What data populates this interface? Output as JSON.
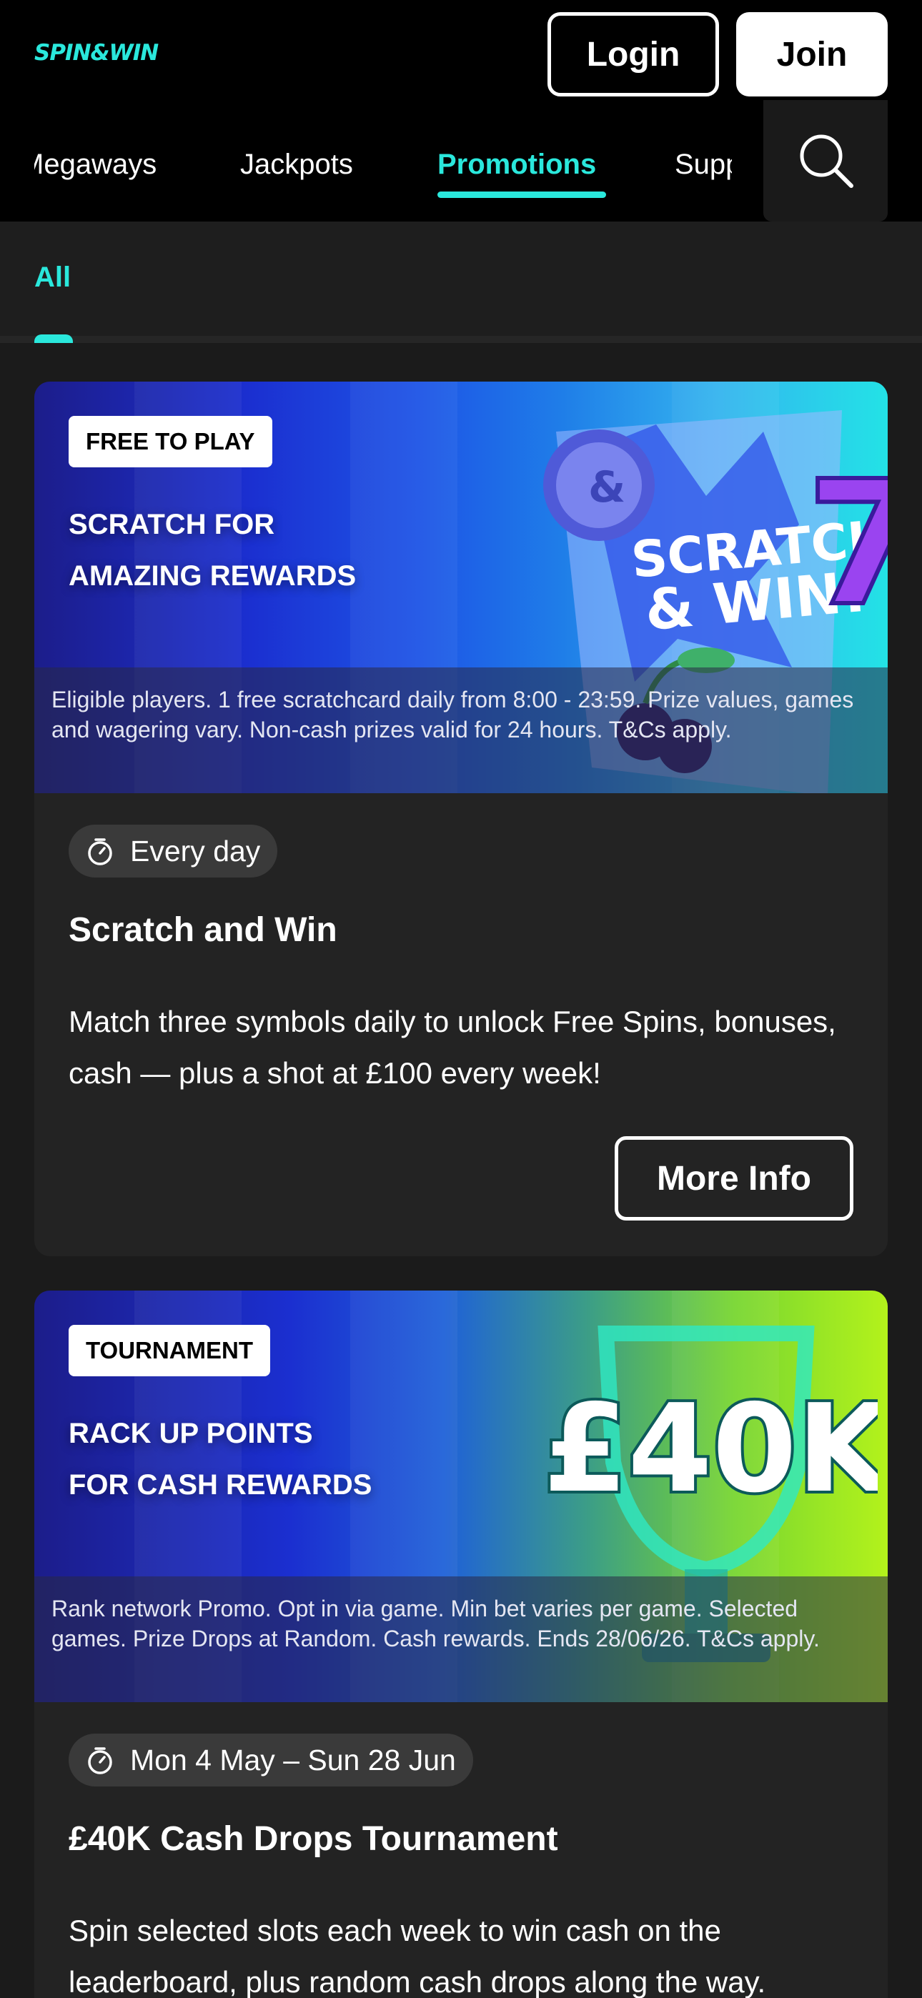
{
  "header": {
    "logo": "SPIN&WIN",
    "login_label": "Login",
    "join_label": "Join"
  },
  "nav": {
    "items": [
      {
        "label": "Megaways"
      },
      {
        "label": "Jackpots"
      },
      {
        "label": "Promotions",
        "active": true
      },
      {
        "label": "Support"
      }
    ],
    "search_icon": "search-icon"
  },
  "filter": {
    "active_label": "All"
  },
  "promotions": [
    {
      "tag": "FREE TO PLAY",
      "headline_line1": "SCRATCH FOR",
      "headline_line2": "AMAZING REWARDS",
      "artwork_text_1": "SCRATCH",
      "artwork_text_2": "& WIN!",
      "terms": "Eligible players. 1 free scratchcard daily from 8:00 - 23:59. Prize values, games and wagering vary. Non-cash prizes valid for 24 hours. T&Cs apply.",
      "dates": "Every day",
      "title": "Scratch and Win",
      "description": "Match three symbols daily to unlock Free Spins, bonuses, cash — plus a shot at £100 every week!",
      "button_label": "More Info"
    },
    {
      "tag": "TOURNAMENT",
      "headline_line1": "RACK UP POINTS",
      "headline_line2": "FOR CASH REWARDS",
      "artwork_text_1": "£40K",
      "terms": "Rank network Promo. Opt in via game. Min bet varies per game. Selected games. Prize Drops at Random. Cash rewards. Ends 28/06/26. T&Cs apply.",
      "dates": "Mon 4 May – Sun 28 Jun",
      "title": "£40K Cash Drops Tournament",
      "description": "Spin selected slots each week to win cash on the leaderboard, plus random cash drops along the way."
    }
  ],
  "colors": {
    "accent": "#2ae8dc",
    "background": "#1b1b1b",
    "card": "#232323"
  }
}
